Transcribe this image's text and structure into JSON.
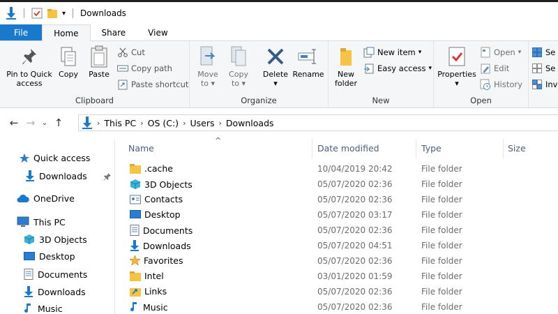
{
  "window": {
    "title": "Downloads"
  },
  "ribbon_tabs": [
    {
      "label": "File"
    },
    {
      "label": "Home"
    },
    {
      "label": "Share"
    },
    {
      "label": "View"
    }
  ],
  "ribbon": {
    "clipboard": {
      "label": "Clipboard",
      "pin_label_1": "Pin to Quick",
      "pin_label_2": "access",
      "copy_label": "Copy",
      "paste_label": "Paste",
      "cut_label": "Cut",
      "copy_path_label": "Copy path",
      "paste_shortcut_label": "Paste shortcut"
    },
    "organize": {
      "label": "Organize",
      "move_to_1": "Move",
      "move_to_2": "to",
      "copy_to_1": "Copy",
      "copy_to_2": "to",
      "delete_label": "Delete",
      "rename_label": "Rename"
    },
    "new": {
      "label": "New",
      "new_folder_1": "New",
      "new_folder_2": "folder",
      "new_item_label": "New item",
      "easy_access_label": "Easy access"
    },
    "open": {
      "label": "Open",
      "properties_label": "Properties",
      "open_label": "Open",
      "edit_label": "Edit",
      "history_label": "History"
    },
    "select": {
      "select_all_partial": "Se",
      "select_none_partial": "Se",
      "invert_partial": "Inv"
    }
  },
  "address": {
    "crumbs": [
      "This PC",
      "OS (C:)",
      "Users",
      "Downloads"
    ]
  },
  "nav_pane": {
    "items": [
      {
        "label": "Quick access",
        "icon": "star-icon"
      },
      {
        "label": "Downloads",
        "icon": "download-arrow-icon"
      },
      {
        "label": "OneDrive",
        "icon": "cloud-icon"
      },
      {
        "label": "This PC",
        "icon": "computer-icon"
      },
      {
        "label": "3D Objects",
        "icon": "cube-icon"
      },
      {
        "label": "Desktop",
        "icon": "desktop-icon"
      },
      {
        "label": "Documents",
        "icon": "document-icon"
      },
      {
        "label": "Downloads",
        "icon": "download-arrow-icon"
      },
      {
        "label": "Music",
        "icon": "music-note-icon"
      }
    ]
  },
  "columns": {
    "name": "Name",
    "date_modified": "Date modified",
    "type": "Type",
    "size": "Size"
  },
  "files": [
    {
      "name": ".cache",
      "date": "10/04/2019 20:42",
      "type": "File folder",
      "icon": "folder-icon"
    },
    {
      "name": "3D Objects",
      "date": "05/07/2020 02:36",
      "type": "File folder",
      "icon": "cube-icon"
    },
    {
      "name": "Contacts",
      "date": "05/07/2020 02:36",
      "type": "File folder",
      "icon": "contacts-icon"
    },
    {
      "name": "Desktop",
      "date": "05/07/2020 03:17",
      "type": "File folder",
      "icon": "desktop-icon"
    },
    {
      "name": "Documents",
      "date": "05/07/2020 02:36",
      "type": "File folder",
      "icon": "document-icon"
    },
    {
      "name": "Downloads",
      "date": "05/07/2020 04:51",
      "type": "File folder",
      "icon": "download-arrow-icon"
    },
    {
      "name": "Favorites",
      "date": "05/07/2020 02:36",
      "type": "File folder",
      "icon": "star-icon"
    },
    {
      "name": "Intel",
      "date": "03/01/2020 01:59",
      "type": "File folder",
      "icon": "folder-icon"
    },
    {
      "name": "Links",
      "date": "05/07/2020 02:36",
      "type": "File folder",
      "icon": "link-icon"
    },
    {
      "name": "Music",
      "date": "05/07/2020 02:36",
      "type": "File folder",
      "icon": "music-note-icon"
    }
  ],
  "colors": {
    "accent": "#1979ca",
    "folder": "#f6c444",
    "header_text": "#4c607a"
  }
}
